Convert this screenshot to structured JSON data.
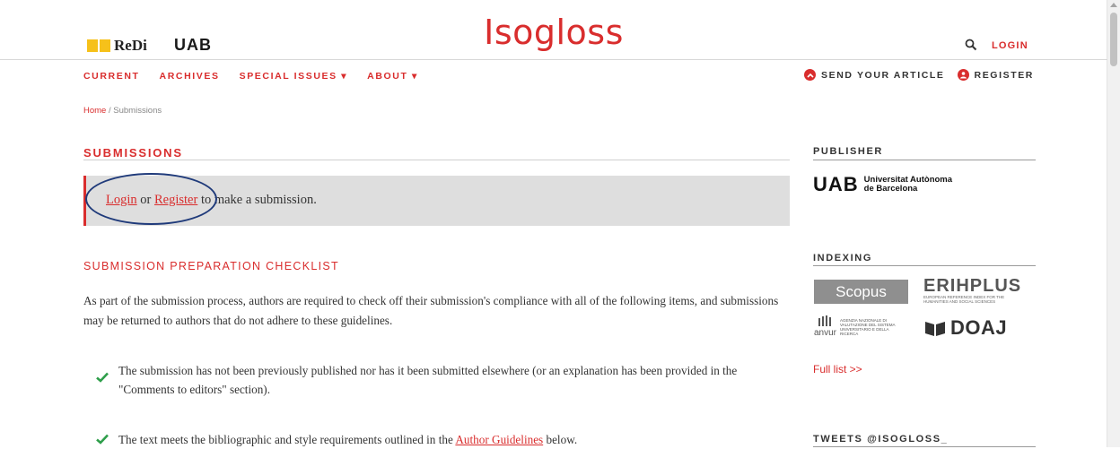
{
  "header": {
    "redi_logo": "ReDi",
    "uab_logo": "UAB",
    "site_title": "Isogloss",
    "login": "LOGIN"
  },
  "nav": {
    "items": [
      "CURRENT",
      "ARCHIVES",
      "SPECIAL ISSUES ▾",
      "ABOUT ▾"
    ],
    "send_article": "SEND YOUR ARTICLE",
    "register": "REGISTER"
  },
  "breadcrumb": {
    "home": "Home",
    "separator": "/",
    "current": "Submissions"
  },
  "main": {
    "title": "SUBMISSIONS",
    "notice": {
      "login": "Login",
      "or": "or",
      "register": "Register",
      "rest": "to make a submission."
    },
    "checklist_title": "SUBMISSION PREPARATION CHECKLIST",
    "intro": "As part of the submission process, authors are required to check off their submission's compliance with all of the following items, and submissions may be returned to authors that do not adhere to these guidelines.",
    "checklist": {
      "item1": "The submission has not been previously published nor has it been submitted elsewhere (or an explanation has been provided in the \"Comments to editors\" section).",
      "item2_before": "The text meets the bibliographic and style requirements outlined in the",
      "item2_link": "Author Guidelines",
      "item2_after": "below."
    }
  },
  "sidebar": {
    "publisher_heading": "PUBLISHER",
    "uab_mark": "UAB",
    "uab_name_line1": "Universitat Autònoma",
    "uab_name_line2": "de Barcelona",
    "indexing_heading": "INDEXING",
    "scopus": "Scopus",
    "erih": "ERIHPLUS",
    "erih_sub": "EUROPEAN REFERENCE INDEX FOR THE HUMANITIES AND SOCIAL SCIENCES",
    "anvur_mark": "anvur",
    "anvur_text": "AGENZIA NAZIONALE DI VALUTAZIONE DEL SISTEMA UNIVERSITARIO E DELLA RICERCA",
    "doaj": "DOAJ",
    "full_list": "Full list >>",
    "tweets_heading": "TWEETS @ISOGLOSS_"
  },
  "colors": {
    "accent": "#d92d2d",
    "notice_bg": "#dedede",
    "highlight": "#1f3a7a",
    "check": "#2e9e4a"
  }
}
